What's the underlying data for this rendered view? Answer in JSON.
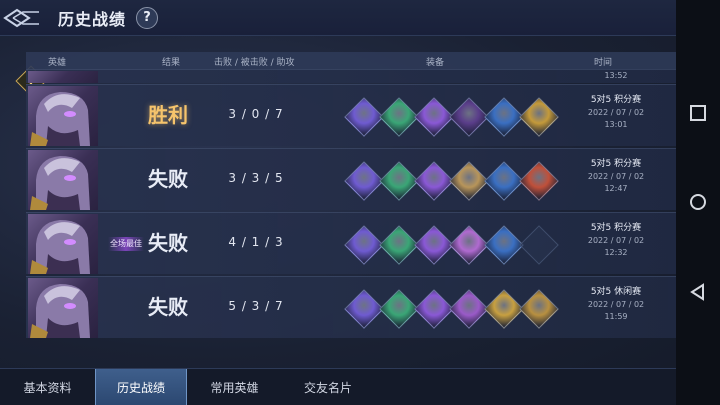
{
  "header": {
    "title": "历史战绩",
    "help_label": "?"
  },
  "table": {
    "columns": {
      "hero": "英雄",
      "result": "结果",
      "kda": "击败 / 被击败 / 助攻",
      "equipment": "装备",
      "time": "时间"
    },
    "partial_row": {
      "time": "13:52"
    },
    "rows": [
      {
        "result": "胜利",
        "result_type": "win",
        "mvp": "",
        "kills": "3",
        "deaths": "0",
        "assists": "7",
        "mode": "5对5 积分赛",
        "date": "2022 / 07 / 02",
        "time": "13:01",
        "items": [
          "#6f5bd1",
          "#3aa676",
          "#8a58d6",
          "#5a3d8a",
          "#3a6fc2",
          "#c49a3a"
        ]
      },
      {
        "result": "失败",
        "result_type": "lose",
        "mvp": "",
        "kills": "3",
        "deaths": "3",
        "assists": "5",
        "mode": "5对5 积分赛",
        "date": "2022 / 07 / 02",
        "time": "12:47",
        "items": [
          "#6f5bd1",
          "#3aa676",
          "#8a58d6",
          "#b8955a",
          "#3a6fc2",
          "#c0503a"
        ]
      },
      {
        "result": "失败",
        "result_type": "lose",
        "mvp": "全场最佳",
        "kills": "4",
        "deaths": "1",
        "assists": "3",
        "mode": "5对5 积分赛",
        "date": "2022 / 07 / 02",
        "time": "12:32",
        "items": [
          "#6f5bd1",
          "#3aa676",
          "#8a58d6",
          "#b06ad0",
          "#3a6fc2",
          ""
        ]
      },
      {
        "result": "失败",
        "result_type": "lose",
        "mvp": "",
        "kills": "5",
        "deaths": "3",
        "assists": "7",
        "mode": "5对5 休闲赛",
        "date": "2022 / 07 / 02",
        "time": "11:59",
        "items": [
          "#6f5bd1",
          "#3aa676",
          "#8a58d6",
          "#9a5ac8",
          "#c8a040",
          "#b89040"
        ]
      }
    ]
  },
  "tabs": [
    {
      "label": "基本资料",
      "active": false
    },
    {
      "label": "历史战绩",
      "active": true
    },
    {
      "label": "常用英雄",
      "active": false
    },
    {
      "label": "交友名片",
      "active": false
    }
  ],
  "icons": {
    "back": "back-diamond-icon",
    "help": "question-icon",
    "alert": "exclamation-icon",
    "row_open": "chevron-right-icon",
    "nav_recents": "square-icon",
    "nav_home": "circle-icon",
    "nav_back": "triangle-back-icon"
  }
}
